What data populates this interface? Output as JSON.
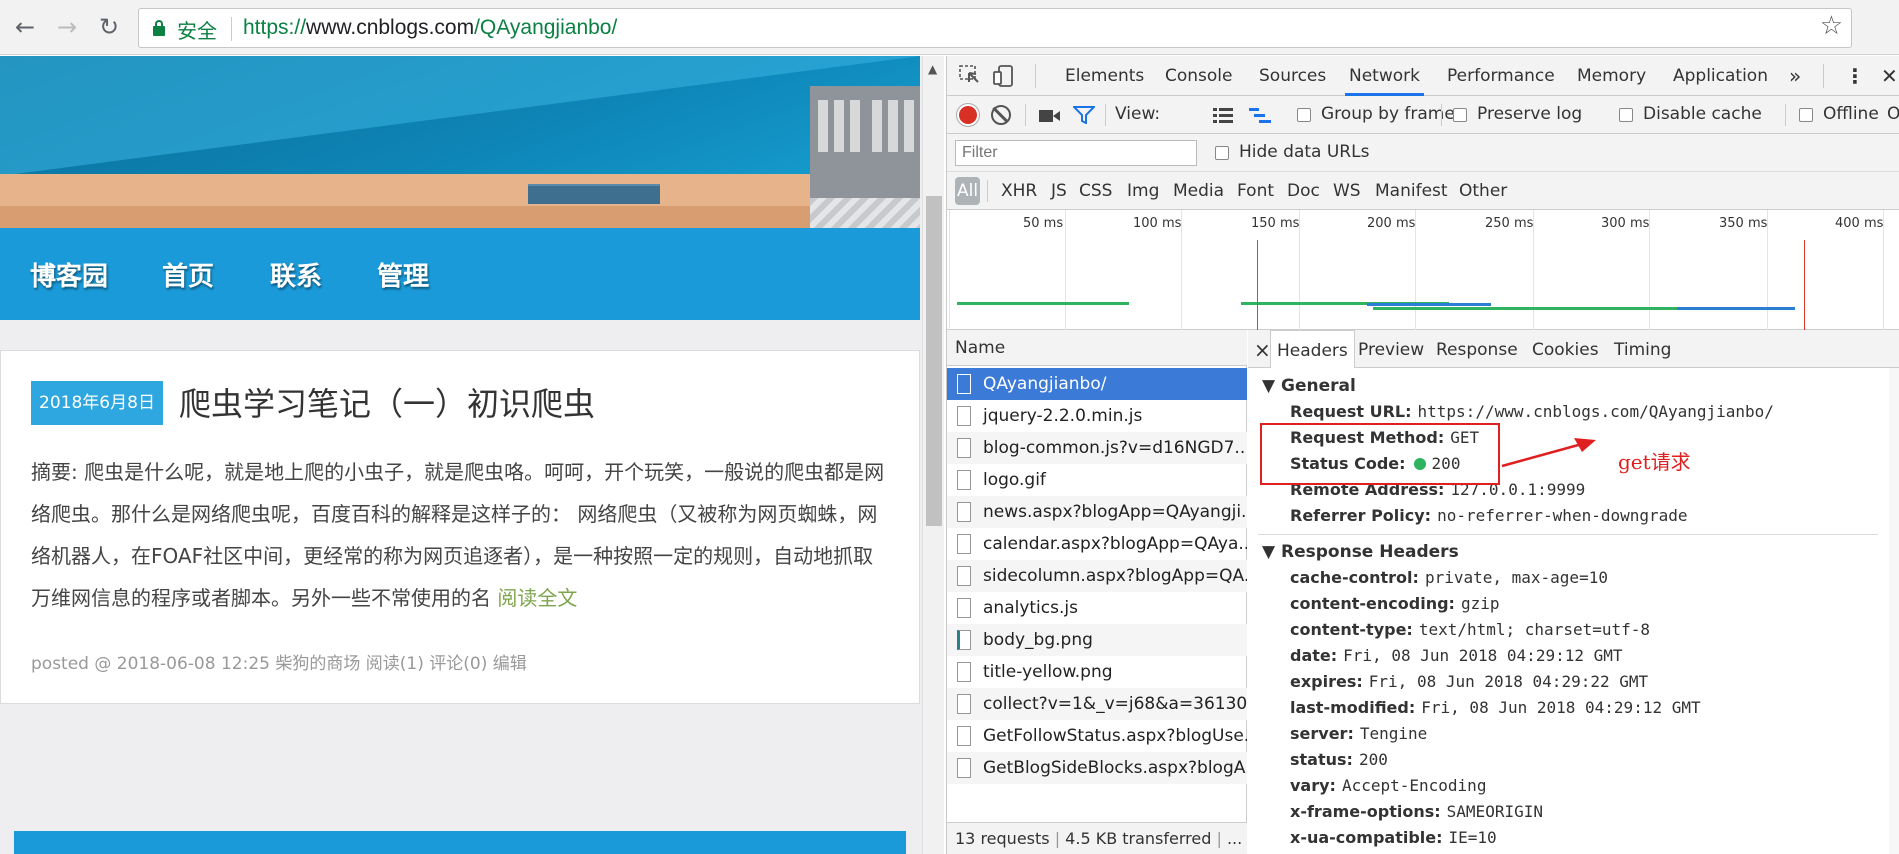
{
  "browser": {
    "secure_label": "安全",
    "url_scheme": "https://",
    "url_host": "www.cnblogs.com",
    "url_path": "/QAyangjianbo/"
  },
  "blog": {
    "nav": [
      "博客园",
      "首页",
      "联系",
      "管理"
    ],
    "post": {
      "date": "2018年6月8日",
      "title": "爬虫学习笔记（一）初识爬虫",
      "summary": "摘要: 爬虫是什么呢，就是地上爬的小虫子，就是爬虫咯。呵呵，开个玩笑，一般说的爬虫都是网络爬虫。那什么是网络爬虫呢，百度百科的解释是这样子的： 网络爬虫（又被称为网页蜘蛛，网络机器人，在FOAF社区中间，更经常的称为网页追逐者），是一种按照一定的规则，自动地抓取万维网信息的程序或者脚本。另外一些不常使用的名",
      "read_more": "阅读全文",
      "meta": "posted @ 2018-06-08 12:25 柴狗的商场 阅读(1) 评论(0) 编辑"
    }
  },
  "devtools": {
    "tabs": [
      "Elements",
      "Console",
      "Sources",
      "Network",
      "Performance",
      "Memory",
      "Application"
    ],
    "active_tab": "Network",
    "more_tabs": "»",
    "toolbar": {
      "view_label": "View:",
      "group_by_frame": "Group by frame",
      "preserve_log": "Preserve log",
      "disable_cache": "Disable cache",
      "offline": "Offline",
      "online_cut": "On"
    },
    "filter": {
      "placeholder": "Filter",
      "hide_data_urls": "Hide data URLs"
    },
    "types": [
      "All",
      "XHR",
      "JS",
      "CSS",
      "Img",
      "Media",
      "Font",
      "Doc",
      "WS",
      "Manifest",
      "Other"
    ],
    "timeline_ticks": [
      "50 ms",
      "100 ms",
      "150 ms",
      "200 ms",
      "250 ms",
      "300 ms",
      "350 ms",
      "400 ms"
    ],
    "list": {
      "header": "Name",
      "items": [
        "QAyangjianbo/",
        "jquery-2.2.0.min.js",
        "blog-common.js?v=d16NGD7...",
        "logo.gif",
        "news.aspx?blogApp=QAyangji...",
        "calendar.aspx?blogApp=QAya...",
        "sidecolumn.aspx?blogApp=QA...",
        "analytics.js",
        "body_bg.png",
        "title-yellow.png",
        "collect?v=1&_v=j68&a=36130...",
        "GetFollowStatus.aspx?blogUse...",
        "GetBlogSideBlocks.aspx?blogA..."
      ],
      "status": [
        "13 requests",
        "4.5 KB transferred",
        "..."
      ]
    },
    "detail": {
      "close": "×",
      "tabs": [
        "Headers",
        "Preview",
        "Response",
        "Cookies",
        "Timing"
      ],
      "general_title": "General",
      "general": [
        {
          "k": "Request URL:",
          "v": "https://www.cnblogs.com/QAyangjianbo/"
        },
        {
          "k": "Request Method:",
          "v": "GET"
        },
        {
          "k": "Status Code:",
          "v": "200"
        },
        {
          "k": "Remote Address:",
          "v": "127.0.0.1:9999"
        },
        {
          "k": "Referrer Policy:",
          "v": "no-referrer-when-downgrade"
        }
      ],
      "response_title": "Response Headers",
      "response": [
        {
          "k": "cache-control:",
          "v": "private, max-age=10"
        },
        {
          "k": "content-encoding:",
          "v": "gzip"
        },
        {
          "k": "content-type:",
          "v": "text/html; charset=utf-8"
        },
        {
          "k": "date:",
          "v": "Fri, 08 Jun 2018 04:29:12 GMT"
        },
        {
          "k": "expires:",
          "v": "Fri, 08 Jun 2018 04:29:22 GMT"
        },
        {
          "k": "last-modified:",
          "v": "Fri, 08 Jun 2018 04:29:12 GMT"
        },
        {
          "k": "server:",
          "v": "Tengine"
        },
        {
          "k": "status:",
          "v": "200"
        },
        {
          "k": "vary:",
          "v": "Accept-Encoding"
        },
        {
          "k": "x-frame-options:",
          "v": "SAMEORIGIN"
        },
        {
          "k": "x-ua-compatible:",
          "v": "IE=10"
        }
      ],
      "annotation": "get请求"
    }
  },
  "colors": {
    "accent": "#1a9ad8",
    "selected_row": "#3c7ad8",
    "annotation": "#e02020",
    "secure": "#0b8043"
  }
}
